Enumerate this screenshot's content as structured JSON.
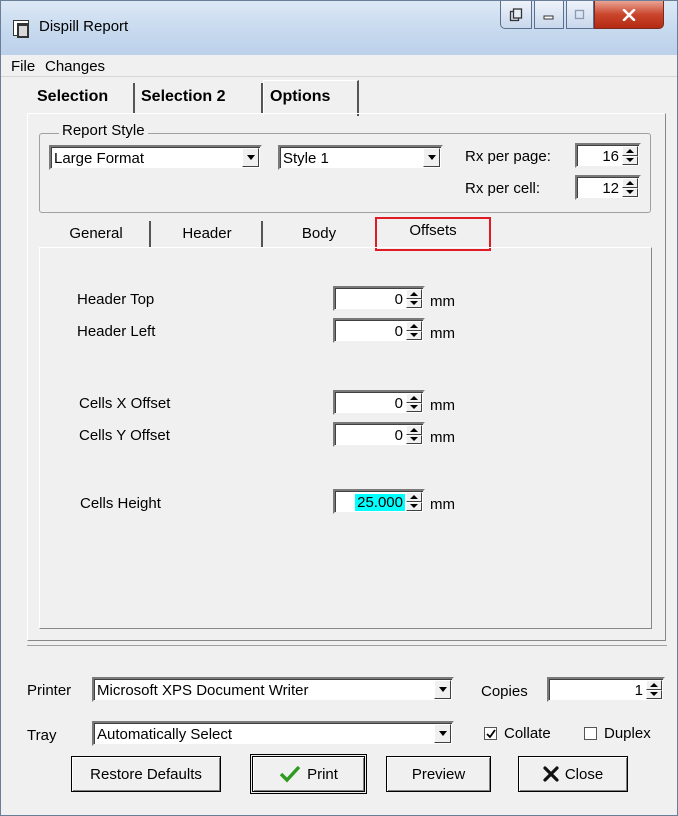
{
  "window": {
    "title": "Dispill Report"
  },
  "menu": {
    "file": "File",
    "changes": "Changes"
  },
  "tabs": {
    "selection": "Selection",
    "selection2": "Selection 2",
    "options": "Options"
  },
  "report_style": {
    "group_label": "Report Style",
    "format": "Large Format",
    "style": "Style 1",
    "rx_per_page_label": "Rx per page:",
    "rx_per_page": "16",
    "rx_per_cell_label": "Rx per cell:",
    "rx_per_cell": "12"
  },
  "inner_tabs": {
    "general": "General",
    "header": "Header",
    "body": "Body",
    "offsets": "Offsets"
  },
  "offsets": {
    "header_top_label": "Header Top",
    "header_top": "0",
    "header_left_label": "Header Left",
    "header_left": "0",
    "cells_x_label": "Cells X Offset",
    "cells_x": "0",
    "cells_y_label": "Cells Y Offset",
    "cells_y": "0",
    "cells_height_label": "Cells Height",
    "cells_height": "25.000",
    "unit": "mm"
  },
  "printer": {
    "label": "Printer",
    "value": "Microsoft XPS Document Writer",
    "copies_label": "Copies",
    "copies": "1",
    "tray_label": "Tray",
    "tray": "Automatically Select",
    "collate_label": "Collate",
    "collate_checked": true,
    "duplex_label": "Duplex",
    "duplex_checked": false
  },
  "buttons": {
    "restore_defaults": "Restore Defaults",
    "print": "Print",
    "preview": "Preview",
    "close": "Close"
  },
  "colors": {
    "highlight": "#00ffff",
    "focus_outline": "#e01b24",
    "print_check": "#2e9a1f",
    "close_x": "#111111"
  }
}
